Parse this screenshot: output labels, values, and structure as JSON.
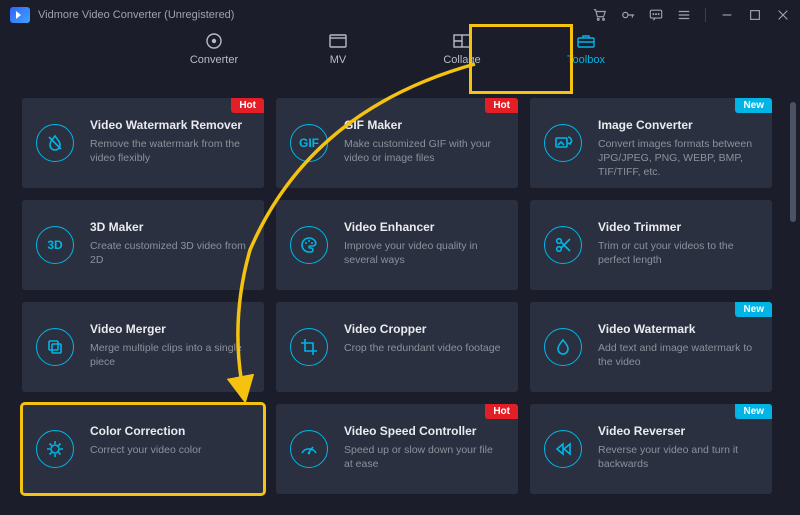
{
  "meta": {
    "domain": "Computer-Use"
  },
  "titlebar": {
    "app_name": "Vidmore Video Converter (Unregistered)"
  },
  "tabs": {
    "items": [
      {
        "id": "converter",
        "label": "Converter",
        "active": false
      },
      {
        "id": "mv",
        "label": "MV",
        "active": false
      },
      {
        "id": "collage",
        "label": "Collage",
        "active": false
      },
      {
        "id": "toolbox",
        "label": "Toolbox",
        "active": true
      }
    ]
  },
  "badges": {
    "hot": "Hot",
    "new": "New"
  },
  "tools": [
    {
      "id": "video-watermark-remover",
      "title": "Video Watermark Remover",
      "desc": "Remove the watermark from the video flexibly",
      "badge": "hot",
      "icon": "droplet-slash"
    },
    {
      "id": "gif-maker",
      "title": "GIF Maker",
      "desc": "Make customized GIF with your video or image files",
      "badge": "hot",
      "icon": "gif-text"
    },
    {
      "id": "image-converter",
      "title": "Image Converter",
      "desc": "Convert images formats between JPG/JPEG, PNG, WEBP, BMP, TIF/TIFF, etc.",
      "badge": "new",
      "icon": "image-convert"
    },
    {
      "id": "3d-maker",
      "title": "3D Maker",
      "desc": "Create customized 3D video from 2D",
      "badge": null,
      "icon": "3d-text"
    },
    {
      "id": "video-enhancer",
      "title": "Video Enhancer",
      "desc": "Improve your video quality in several ways",
      "badge": null,
      "icon": "palette"
    },
    {
      "id": "video-trimmer",
      "title": "Video Trimmer",
      "desc": "Trim or cut your videos to the perfect length",
      "badge": null,
      "icon": "scissors"
    },
    {
      "id": "video-merger",
      "title": "Video Merger",
      "desc": "Merge multiple clips into a single piece",
      "badge": null,
      "icon": "layers"
    },
    {
      "id": "video-cropper",
      "title": "Video Cropper",
      "desc": "Crop the redundant video footage",
      "badge": null,
      "icon": "crop"
    },
    {
      "id": "video-watermark",
      "title": "Video Watermark",
      "desc": "Add text and image watermark to the video",
      "badge": "new",
      "icon": "droplet"
    },
    {
      "id": "color-correction",
      "title": "Color Correction",
      "desc": "Correct your video color",
      "badge": null,
      "icon": "color-wheel",
      "highlight": true
    },
    {
      "id": "video-speed-controller",
      "title": "Video Speed Controller",
      "desc": "Speed up or slow down your file at ease",
      "badge": "hot",
      "icon": "speedometer"
    },
    {
      "id": "video-reverser",
      "title": "Video Reverser",
      "desc": "Reverse your video and turn it backwards",
      "badge": "new",
      "icon": "rewind"
    }
  ],
  "annotation": {
    "highlight_tab": "toolbox",
    "highlight_tool": "color-correction",
    "arrow_from": "toolbox-tab",
    "arrow_to": "color-correction-card"
  }
}
